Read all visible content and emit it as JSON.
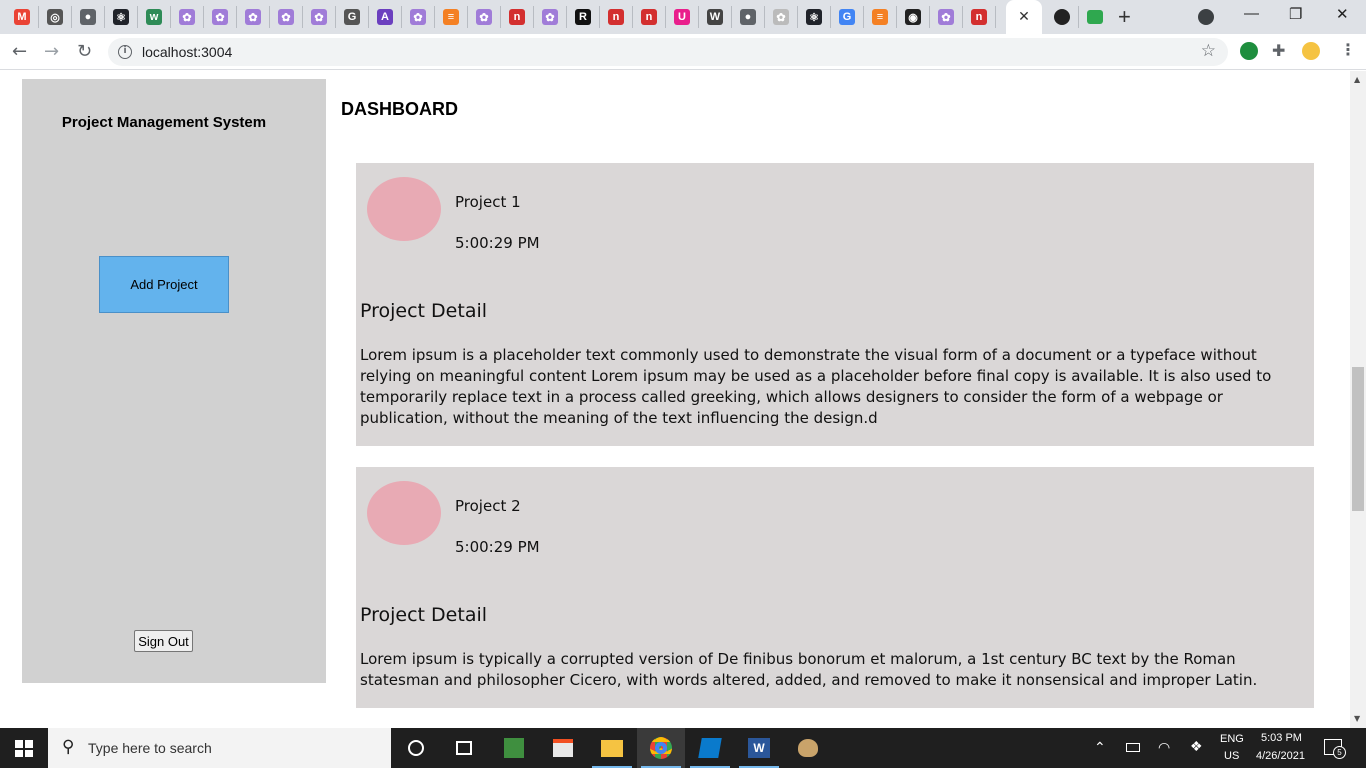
{
  "browser": {
    "url": "localhost:3004",
    "close_tab_glyph": "✕",
    "new_tab_glyph": "+",
    "min_glyph": "—",
    "max_glyph": "❐",
    "close_glyph": "✕",
    "tab_icons": [
      {
        "name": "gmail-icon",
        "glyph": "M",
        "color": "#ea4335"
      },
      {
        "name": "glasses-icon",
        "glyph": "◎",
        "color": "#555555"
      },
      {
        "name": "globe-icon",
        "glyph": "●",
        "color": "#5f6368"
      },
      {
        "name": "react-icon",
        "glyph": "⚛",
        "color": "#20232a"
      },
      {
        "name": "w-icon",
        "glyph": "w",
        "color": "#2e8b57"
      },
      {
        "name": "openai-icon",
        "glyph": "✿",
        "color": "#a07cd8"
      },
      {
        "name": "openai-icon",
        "glyph": "✿",
        "color": "#a07cd8"
      },
      {
        "name": "openai-icon",
        "glyph": "✿",
        "color": "#a07cd8"
      },
      {
        "name": "openai-icon",
        "glyph": "✿",
        "color": "#a07cd8"
      },
      {
        "name": "openai-icon",
        "glyph": "✿",
        "color": "#a07cd8"
      },
      {
        "name": "doc-icon",
        "glyph": "G",
        "color": "#555555"
      },
      {
        "name": "a-icon",
        "glyph": "A",
        "color": "#6b3fbf"
      },
      {
        "name": "openai-icon",
        "glyph": "✿",
        "color": "#a07cd8"
      },
      {
        "name": "stackoverflow-icon",
        "glyph": "≡",
        "color": "#f48024"
      },
      {
        "name": "openai-icon",
        "glyph": "✿",
        "color": "#a07cd8"
      },
      {
        "name": "n-icon",
        "glyph": "n",
        "color": "#d32f2f"
      },
      {
        "name": "openai-icon",
        "glyph": "✿",
        "color": "#a07cd8"
      },
      {
        "name": "r-icon",
        "glyph": "R",
        "color": "#111111"
      },
      {
        "name": "n-icon",
        "glyph": "n",
        "color": "#d32f2f"
      },
      {
        "name": "n-icon",
        "glyph": "n",
        "color": "#d32f2f"
      },
      {
        "name": "u-icon",
        "glyph": "U",
        "color": "#e91e8c"
      },
      {
        "name": "wikipedia-icon",
        "glyph": "W",
        "color": "#444444"
      },
      {
        "name": "globe-icon",
        "glyph": "●",
        "color": "#5f6368"
      },
      {
        "name": "openai-icon",
        "glyph": "✿",
        "color": "#bbbbbb"
      },
      {
        "name": "react-icon",
        "glyph": "⚛",
        "color": "#20232a"
      },
      {
        "name": "google-icon",
        "glyph": "G",
        "color": "#4285f4"
      },
      {
        "name": "stackoverflow-icon",
        "glyph": "≡",
        "color": "#f48024"
      },
      {
        "name": "github-icon",
        "glyph": "◉",
        "color": "#222222"
      },
      {
        "name": "openai-icon",
        "glyph": "✿",
        "color": "#a07cd8"
      },
      {
        "name": "n-icon",
        "glyph": "n",
        "color": "#d32f2f"
      }
    ]
  },
  "sidebar": {
    "title": "Project Management System",
    "add_button": "Add Project",
    "signout_button": "Sign Out"
  },
  "main": {
    "title": "DASHBOARD",
    "projects": [
      {
        "name": "Project 1",
        "time": "5:00:29 PM",
        "detail_title": "Project Detail",
        "detail_text": "Lorem ipsum is a placeholder text commonly used to demonstrate the visual form of a document or a typeface without relying on meaningful content Lorem ipsum may be used as a placeholder before final copy is available. It is also used to temporarily replace text in a process called greeking, which allows designers to consider the form of a webpage or publication, without the meaning of the text influencing the design.d"
      },
      {
        "name": "Project 2",
        "time": "5:00:29 PM",
        "detail_title": "Project Detail",
        "detail_text": "Lorem ipsum is typically a corrupted version of De finibus bonorum et malorum, a 1st century BC text by the Roman statesman and philosopher Cicero, with words altered, added, and removed to make it nonsensical and improper Latin."
      }
    ],
    "avatar_color": "#e8aab4",
    "card_color": "#dad7d7",
    "add_button_color": "#63b3ed"
  },
  "taskbar": {
    "search_placeholder": "Type here to search",
    "lang_top": "ENG",
    "lang_bottom": "US",
    "time": "5:03 PM",
    "date": "4/26/2021",
    "notification_count": "5"
  }
}
